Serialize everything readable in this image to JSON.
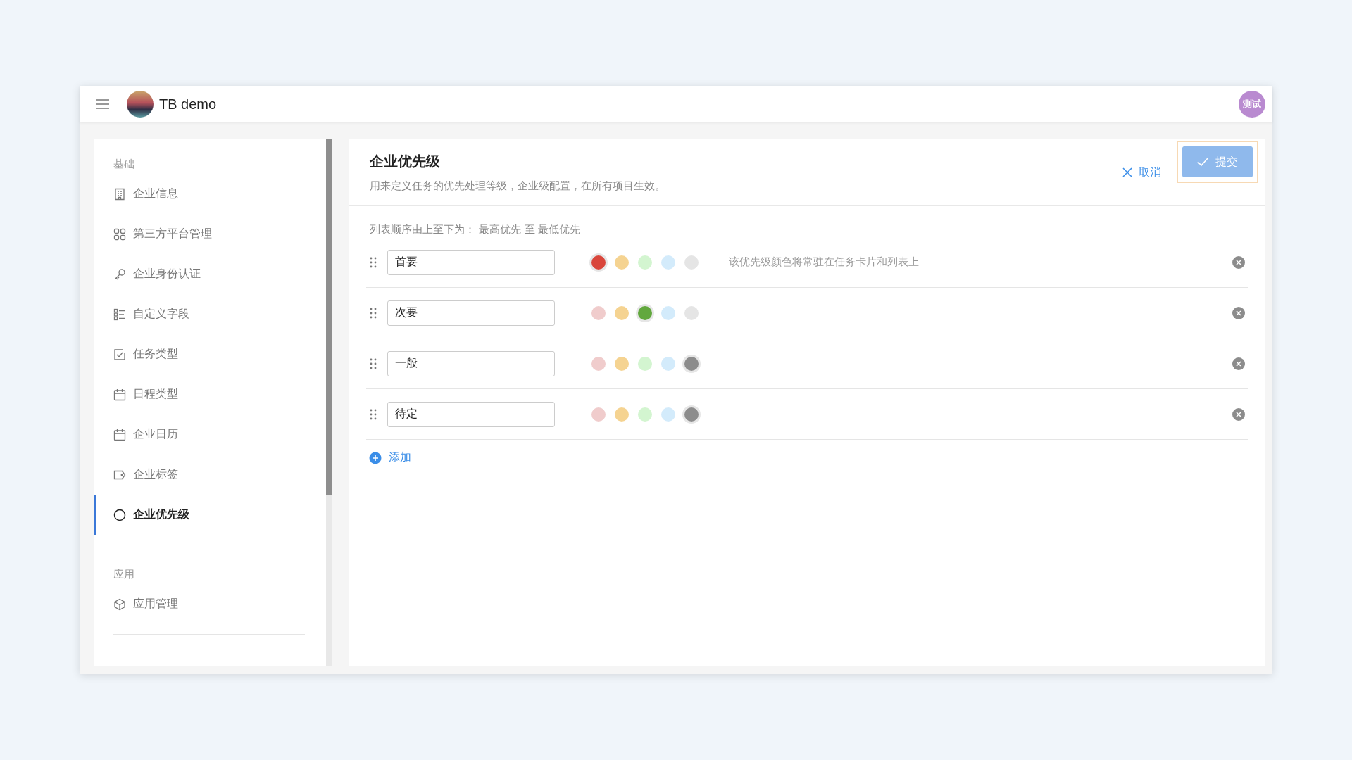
{
  "header": {
    "app_name": "TB demo",
    "user_avatar": "测试"
  },
  "sidebar": {
    "sections": [
      {
        "title": "基础",
        "items": [
          {
            "label": "企业信息",
            "selected": false
          },
          {
            "label": "第三方平台管理",
            "selected": false
          },
          {
            "label": "企业身份认证",
            "selected": false
          },
          {
            "label": "自定义字段",
            "selected": false
          },
          {
            "label": "任务类型",
            "selected": false
          },
          {
            "label": "日程类型",
            "selected": false
          },
          {
            "label": "企业日历",
            "selected": false
          },
          {
            "label": "企业标签",
            "selected": false
          },
          {
            "label": "企业优先级",
            "selected": true
          }
        ]
      },
      {
        "title": "应用",
        "items": [
          {
            "label": "应用管理",
            "selected": false
          }
        ]
      }
    ]
  },
  "main": {
    "title": "企业优先级",
    "description": "用来定义任务的优先处理等级，企业级配置，在所有项目生效。",
    "cancel_button": "取消",
    "submit_button": "提交",
    "order_hint": "列表顺序由上至下为： 最高优先 至 最低优先",
    "priorities": [
      {
        "name": "首要",
        "note": "该优先级颜色将常驻在任务卡片和列表上",
        "swatches": [
          {
            "color": "#d9463b",
            "selected": true
          },
          {
            "color": "#f5d391",
            "selected": false
          },
          {
            "color": "#d3f5d0",
            "selected": false
          },
          {
            "color": "#d3ebfb",
            "selected": false
          },
          {
            "color": "#e5e5e5",
            "selected": false
          }
        ]
      },
      {
        "name": "次要",
        "swatches": [
          {
            "color": "#f0cccc",
            "selected": false
          },
          {
            "color": "#f5d391",
            "selected": false
          },
          {
            "color": "#62a83e",
            "selected": true
          },
          {
            "color": "#d3ebfb",
            "selected": false
          },
          {
            "color": "#e5e5e5",
            "selected": false
          }
        ]
      },
      {
        "name": "一般",
        "swatches": [
          {
            "color": "#f0cccc",
            "selected": false
          },
          {
            "color": "#f5d391",
            "selected": false
          },
          {
            "color": "#d3f5d0",
            "selected": false
          },
          {
            "color": "#d3ebfb",
            "selected": false
          },
          {
            "color": "#8c8c8c",
            "selected": true
          }
        ]
      },
      {
        "name": "待定",
        "swatches": [
          {
            "color": "#f0cccc",
            "selected": false
          },
          {
            "color": "#f5d391",
            "selected": false
          },
          {
            "color": "#d3f5d0",
            "selected": false
          },
          {
            "color": "#d3ebfb",
            "selected": false
          },
          {
            "color": "#8c8c8c",
            "selected": true
          }
        ]
      }
    ],
    "add_button": "添加"
  }
}
